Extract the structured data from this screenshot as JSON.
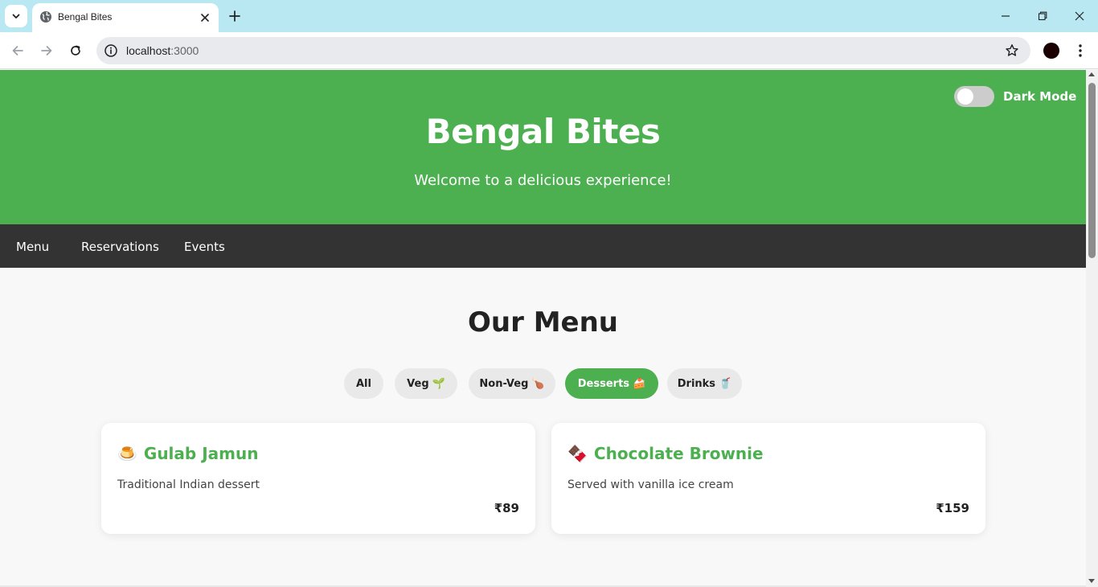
{
  "browser": {
    "tab_title": "Bengal Bites",
    "url_host": "localhost",
    "url_port": ":3000"
  },
  "hero": {
    "title": "Bengal Bites",
    "subtitle": "Welcome to a delicious experience!",
    "dark_mode_label": "Dark Mode",
    "dark_mode_on": false
  },
  "nav": {
    "items": [
      {
        "label": "Menu"
      },
      {
        "label": "Reservations"
      },
      {
        "label": "Events"
      }
    ]
  },
  "menu": {
    "heading": "Our Menu",
    "filters": [
      {
        "label": "All",
        "emoji": ""
      },
      {
        "label": "Veg",
        "emoji": "🌱"
      },
      {
        "label": "Non-Veg",
        "emoji": "🍗"
      },
      {
        "label": "Desserts",
        "emoji": "🍰",
        "active": true
      },
      {
        "label": "Drinks",
        "emoji": "🥤"
      }
    ],
    "items": [
      {
        "emoji": "🍮",
        "name": "Gulab Jamun",
        "description": "Traditional Indian dessert",
        "price": "₹89"
      },
      {
        "emoji": "🍫",
        "name": "Chocolate Brownie",
        "description": "Served with vanilla ice cream",
        "price": "₹159"
      }
    ]
  },
  "colors": {
    "accent": "#4caf50",
    "navbar": "#333333",
    "tabstrip": "#b9e8f3"
  },
  "icons": {
    "tab_search": "chevron-down-icon",
    "favicon": "globe-icon",
    "tab_close": "close-icon",
    "new_tab": "plus-icon",
    "back": "arrow-left-icon",
    "forward": "arrow-right-icon",
    "reload": "reload-icon",
    "site_info": "info-icon",
    "bookmark": "star-icon",
    "menu": "kebab-icon"
  }
}
